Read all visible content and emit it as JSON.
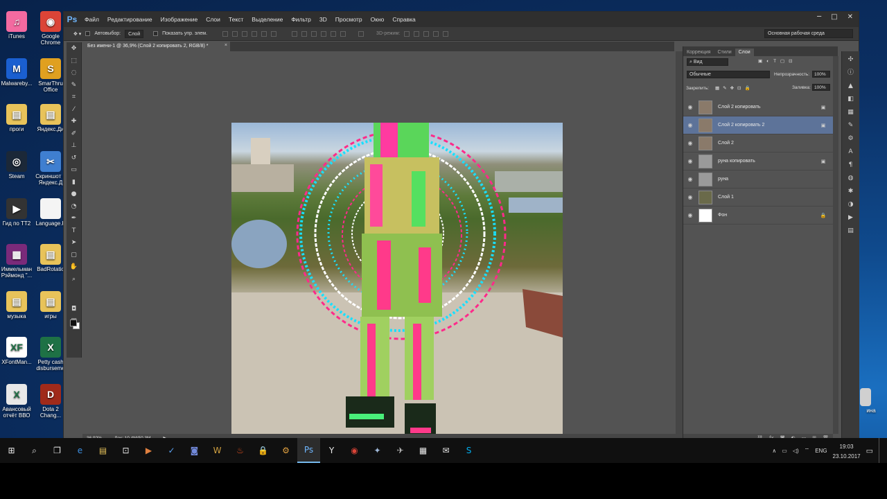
{
  "desktop": {
    "icons": [
      {
        "label": "iTunes",
        "icon": "itunes-icon",
        "color": "#f36aa0",
        "glyph": "♫"
      },
      {
        "label": "Google Chrome",
        "icon": "chrome-icon",
        "color": "#db4437",
        "glyph": "◉"
      },
      {
        "label": "Malwareby...",
        "icon": "malwarebytes-icon",
        "color": "#1a5fd0",
        "glyph": "M"
      },
      {
        "label": "SmarThru Office",
        "icon": "smarthru-icon",
        "color": "#e0a020",
        "glyph": "S"
      },
      {
        "label": "проги",
        "icon": "folder-icon",
        "color": "#e8c35a",
        "glyph": "▤"
      },
      {
        "label": "Яндекс.Ди",
        "icon": "folder-icon",
        "color": "#e8c35a",
        "glyph": "▤"
      },
      {
        "label": "Steam",
        "icon": "steam-icon",
        "color": "#1b2838",
        "glyph": "◎"
      },
      {
        "label": "Скриншот в Яндекс.Д",
        "icon": "screenshot-icon",
        "color": "#3f7fd0",
        "glyph": "✂"
      },
      {
        "label": "Гид по TT2",
        "icon": "video-file-icon",
        "color": "#333333",
        "glyph": "▶"
      },
      {
        "label": "Language.F",
        "icon": "file-icon",
        "color": "#f4f4f4",
        "glyph": ""
      },
      {
        "label": "Иммельман Рэймонд \"...",
        "icon": "winrar-icon",
        "color": "#7a2a7a",
        "glyph": "▦"
      },
      {
        "label": "BadRotatio",
        "icon": "folder-icon",
        "color": "#e8c35a",
        "glyph": "▤"
      },
      {
        "label": "музыка",
        "icon": "folder-icon",
        "color": "#e8c35a",
        "glyph": "▤"
      },
      {
        "label": "игры",
        "icon": "folder-icon",
        "color": "#e8c35a",
        "glyph": "▤"
      },
      {
        "label": "XFontMan...",
        "icon": "xfontman-icon",
        "color": "#ffffff",
        "glyph": "XF"
      },
      {
        "label": "Petty cash disburseme",
        "icon": "excel-icon",
        "color": "#1e7145",
        "glyph": "X"
      },
      {
        "label": "Авансовый отчёт ВВО",
        "icon": "excel-icon",
        "color": "#e8e8e8",
        "glyph": "X"
      },
      {
        "label": "Dota 2 Chang...",
        "icon": "dota-icon",
        "color": "#a02a1a",
        "glyph": "D"
      }
    ],
    "partial_label": "ина"
  },
  "photoshop": {
    "logo": "Ps",
    "menu": [
      "Файл",
      "Редактирование",
      "Изображение",
      "Слои",
      "Текст",
      "Выделение",
      "Фильтр",
      "3D",
      "Просмотр",
      "Окно",
      "Справка"
    ],
    "window_controls": {
      "minimize": "─",
      "maximize": "□",
      "close": "✕"
    },
    "options": {
      "autoselect_label": "Автовыбор:",
      "autoselect_value": "Слой",
      "show_controls_label": "Показать упр. элем.",
      "mode_3d_label": "3D-режим:",
      "workspace": "Основная рабочая среда"
    },
    "document_tab": {
      "title": "Без имени-1 @ 36,9% (Слой 2 копировать 2, RGB/8) *",
      "close": "×"
    },
    "status": {
      "zoom": "36.92%",
      "doc_size": "Док: 10,4M/50,3M"
    },
    "panel_tabs": [
      "Коррекция",
      "Стили",
      "Слои"
    ],
    "layers_panel": {
      "filter_kind": "Вид",
      "blend_mode": "Обычные",
      "opacity_label": "Непрозрачность:",
      "opacity_value": "100%",
      "lock_label": "Закрепить:",
      "fill_label": "Заливка:",
      "fill_value": "100%",
      "layers": [
        {
          "name": "Слой 2 копировать",
          "selected": false,
          "thumb": "#8a7a6a",
          "badge": "▣"
        },
        {
          "name": "Слой 2 копировать 2",
          "selected": true,
          "thumb": "#8a7a6a",
          "badge": "▣"
        },
        {
          "name": "Слой 2",
          "selected": false,
          "thumb": "#8a7a6a",
          "badge": ""
        },
        {
          "name": "руна копировать",
          "selected": false,
          "thumb": "#9a9a9a",
          "badge": "▣"
        },
        {
          "name": "руна",
          "selected": false,
          "thumb": "#9a9a9a",
          "badge": ""
        },
        {
          "name": "Слой 1",
          "selected": false,
          "thumb": "#6a6a4a",
          "badge": ""
        },
        {
          "name": "Фон",
          "selected": false,
          "thumb": "#ffffff",
          "badge": "🔒"
        }
      ]
    }
  },
  "taskbar": {
    "language": "ENG",
    "time": "19:03",
    "date": "23.10.2017"
  }
}
